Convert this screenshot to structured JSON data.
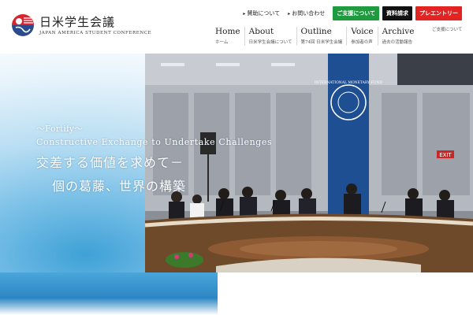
{
  "logo": {
    "title": "日米学生会議",
    "subtitle": "JAPAN AMERICA STUDENT CONFERENCE"
  },
  "topbar": {
    "links": [
      {
        "mark": "▸",
        "label": "賛助について"
      },
      {
        "mark": "▸",
        "label": "お問い合わせ"
      }
    ],
    "buttons": [
      {
        "label": "ご支援について",
        "color": "#1f9a3f"
      },
      {
        "label": "資料請求",
        "color": "#111111"
      },
      {
        "label": "プレエントリー",
        "color": "#e32222"
      }
    ]
  },
  "nav": {
    "items": [
      {
        "en": "Home",
        "jp": "ホーム"
      },
      {
        "en": "About",
        "jp": "日米学生会議について"
      },
      {
        "en": "Outline",
        "jp": "第74回 日米学生会議"
      },
      {
        "en": "Voice",
        "jp": "参加者の声"
      },
      {
        "en": "Archive",
        "jp": "過去の活動報告"
      }
    ],
    "extra": "ご支援について"
  },
  "hero": {
    "line1": "～Fortify～",
    "line2": "Constructive Exchange to Undertake Challenges",
    "line3": "交差する価値を求めて－",
    "line4": "個の葛藤、世界の構築",
    "banner_text": "INTERNATIONAL MONETARY FUND",
    "exit_sign": "EXIT"
  }
}
